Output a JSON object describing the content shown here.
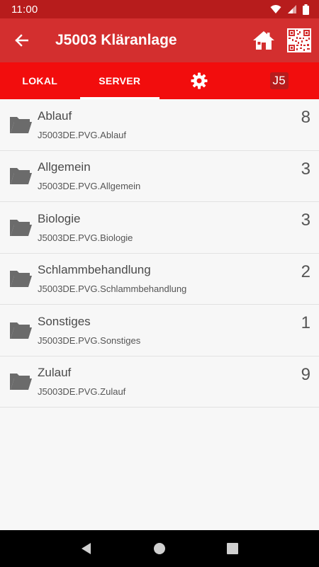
{
  "status_bar": {
    "time": "11:00"
  },
  "app_bar": {
    "title": "J5003 Kläranlage"
  },
  "tabs": [
    {
      "label": "LOKAL"
    },
    {
      "label": "SERVER"
    },
    {
      "label": ""
    },
    {
      "label": "J5"
    }
  ],
  "list": [
    {
      "title": "Ablauf",
      "subtitle": "J5003DE.PVG.Ablauf",
      "count": "8"
    },
    {
      "title": "Allgemein",
      "subtitle": "J5003DE.PVG.Allgemein",
      "count": "3"
    },
    {
      "title": "Biologie",
      "subtitle": "J5003DE.PVG.Biologie",
      "count": "3"
    },
    {
      "title": "Schlammbehandlung",
      "subtitle": "J5003DE.PVG.Schlammbehandlung",
      "count": "2"
    },
    {
      "title": "Sonstiges",
      "subtitle": "J5003DE.PVG.Sonstiges",
      "count": "1"
    },
    {
      "title": "Zulauf",
      "subtitle": "J5003DE.PVG.Zulauf",
      "count": "9"
    }
  ],
  "colors": {
    "status_bar": "#b71c1c",
    "app_bar": "#d32f2f",
    "tab_bar": "#f20d0d",
    "folder": "#6b6b6b"
  },
  "icons": [
    "back-arrow-icon",
    "home-icon",
    "qr-code-icon",
    "gear-icon",
    "folder-icon",
    "wifi-icon",
    "signal-icon",
    "battery-icon"
  ]
}
